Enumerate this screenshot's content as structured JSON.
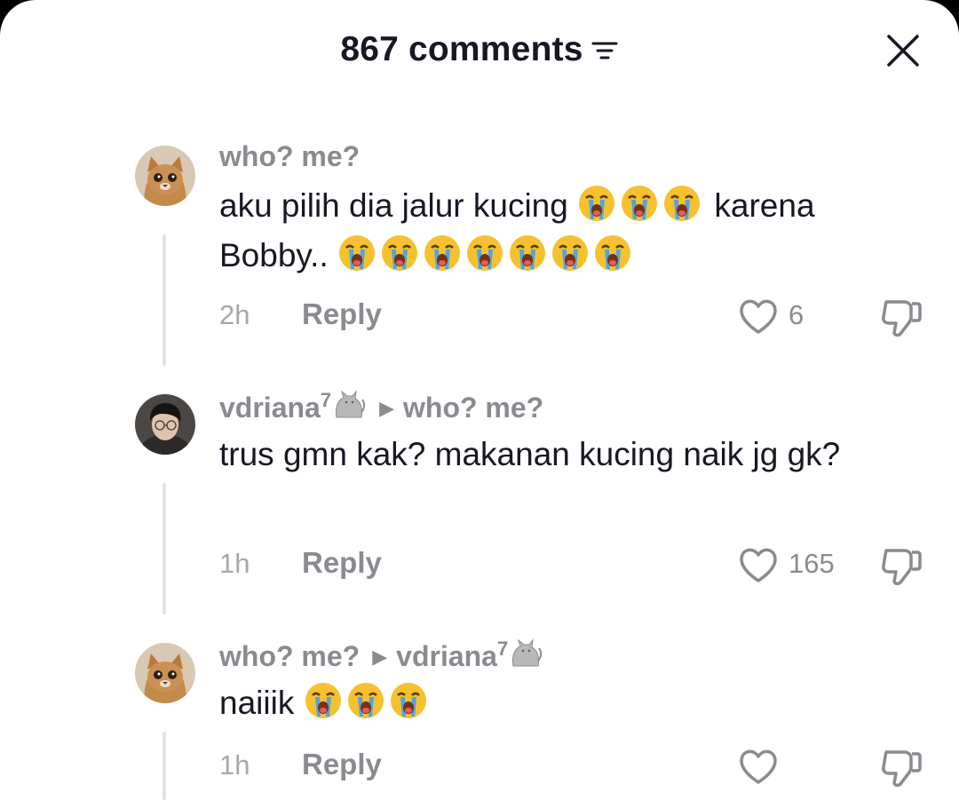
{
  "header": {
    "comment_count": "867 comments",
    "sort_icon": "sort-filter-icon",
    "close_icon": "close-icon"
  },
  "comments": [
    {
      "username": "who? me?",
      "text_before": "aku pilih dia jalur kucing",
      "text_middle": "karena",
      "text_line2": "Bobby..",
      "time": "2h",
      "reply_label": "Reply",
      "likes": "6",
      "avatar_icon": "cat-avatar"
    },
    {
      "username": "vdriana",
      "username_badge": "7",
      "username_emoji": "cat-emoji",
      "reply_to": "who? me?",
      "text": "trus gmn kak? makanan kucing naik jg gk?",
      "time": "1h",
      "reply_label": "Reply",
      "likes": "165",
      "avatar_icon": "person-avatar"
    },
    {
      "username": "who? me?",
      "reply_to": "vdriana",
      "reply_to_badge": "7",
      "text": "naiiik",
      "time": "1h",
      "reply_label": "Reply",
      "likes": "",
      "avatar_icon": "cat-avatar"
    }
  ],
  "colors": {
    "text_primary": "#161823",
    "text_secondary": "#8a8b91",
    "thread_line": "#e3e3e4"
  }
}
